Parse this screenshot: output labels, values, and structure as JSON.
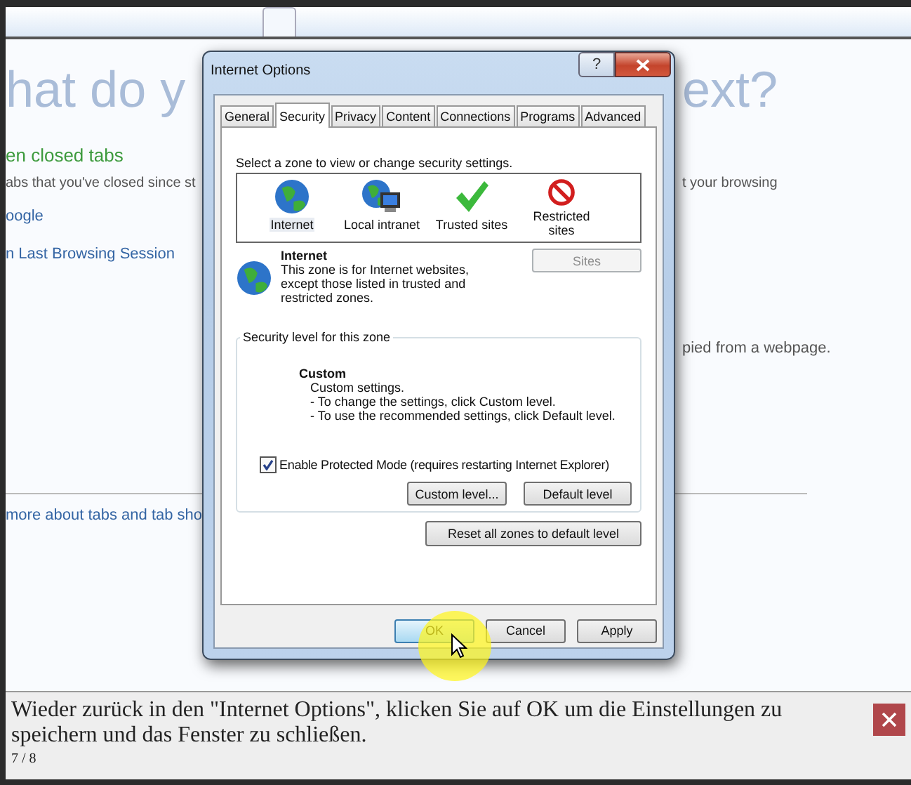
{
  "browser": {
    "lines": [
      {
        "kind": "title",
        "left": "hat do y",
        "right": "ext?"
      },
      {
        "kind": "section",
        "left": "en closed tabs"
      },
      {
        "kind": "text",
        "left": "abs that you've closed since st",
        "right": "t your browsing"
      },
      {
        "kind": "link",
        "left": "oogle"
      },
      {
        "kind": "link",
        "left": "n Last Browsing Session"
      },
      {
        "kind": "note",
        "right": "pied from a webpage."
      },
      {
        "kind": "footer",
        "left": "more about tabs and tab sho"
      }
    ]
  },
  "dialog": {
    "title": "Internet Options",
    "help": "?",
    "tabs": [
      {
        "label": "General",
        "selected": false
      },
      {
        "label": "Security",
        "selected": true
      },
      {
        "label": "Privacy",
        "selected": false
      },
      {
        "label": "Content",
        "selected": false
      },
      {
        "label": "Connections",
        "selected": false
      },
      {
        "label": "Programs",
        "selected": false
      },
      {
        "label": "Advanced",
        "selected": false
      }
    ],
    "zone_prompt": "Select a zone to view or change security settings.",
    "zones": [
      {
        "label": "Internet",
        "kind": "globe",
        "selected": true
      },
      {
        "label": "Local intranet",
        "kind": "intranet",
        "selected": false
      },
      {
        "label": "Trusted sites",
        "kind": "check",
        "selected": false
      },
      {
        "label": "Restricted sites",
        "kind": "blocked",
        "selected": false
      }
    ],
    "zone_name": "Internet",
    "zone_description": "This zone is for Internet websites, except those listed in trusted and restricted zones.",
    "sites_button": {
      "label": "Sites",
      "disabled": true
    },
    "group_title": "Security level for this zone",
    "level_name": "Custom",
    "level_lines": [
      "Custom settings.",
      "- To change the settings, click Custom level.",
      "- To use the recommended settings, click Default level."
    ],
    "protected_mode": {
      "label": "Enable Protected Mode (requires restarting Internet Explorer)",
      "checked": true
    },
    "level_buttons": [
      "Custom level...",
      "Default level"
    ],
    "reset_button": "Reset all zones to default level",
    "footer_buttons": [
      {
        "label": "OK",
        "focused": true
      },
      {
        "label": "Cancel",
        "focused": false
      },
      {
        "label": "Apply",
        "focused": false
      }
    ]
  },
  "caption": {
    "text": "Wieder zurück in den \"Internet Options\", klicken Sie auf OK um die Einstellungen zu speichern und das Fenster zu schließen.",
    "counter": "7 / 8"
  }
}
